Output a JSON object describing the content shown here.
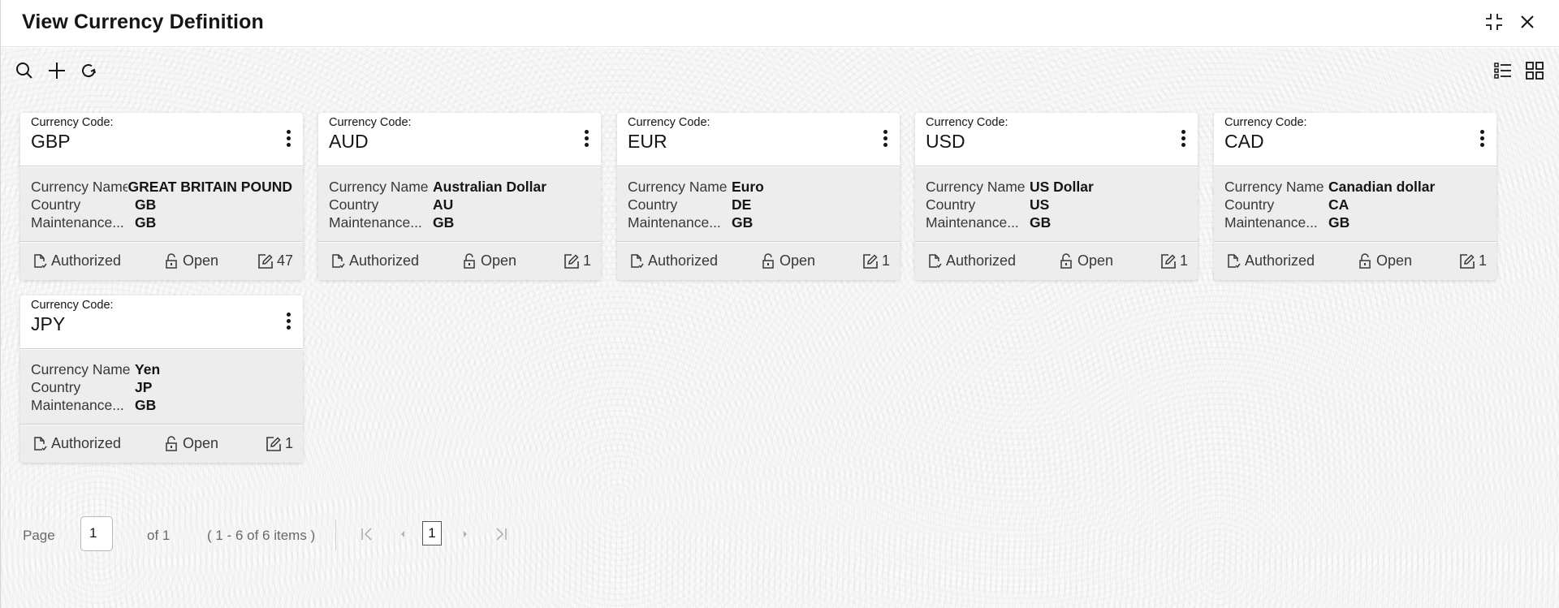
{
  "window": {
    "title": "View Currency Definition",
    "controls": {
      "minimize_icon": "collapse-icon",
      "close_icon": "close-icon"
    }
  },
  "toolbar": {
    "left": [
      "search-icon",
      "add-icon",
      "refresh-icon"
    ],
    "right": [
      "list-view-icon",
      "tile-view-icon"
    ]
  },
  "card_labels": {
    "code_label": "Currency Code:",
    "currency_name": "Currency Name",
    "country": "Country",
    "maintenance": "Maintenance..."
  },
  "cards": [
    {
      "code": "GBP",
      "currency_name": "GREAT BRITAIN POUND",
      "country": "GB",
      "maintenance": "GB",
      "auth_status": "Authorized",
      "record_status": "Open",
      "mod_count": "47"
    },
    {
      "code": "AUD",
      "currency_name": "Australian Dollar",
      "country": "AU",
      "maintenance": "GB",
      "auth_status": "Authorized",
      "record_status": "Open",
      "mod_count": "1"
    },
    {
      "code": "EUR",
      "currency_name": "Euro",
      "country": "DE",
      "maintenance": "GB",
      "auth_status": "Authorized",
      "record_status": "Open",
      "mod_count": "1"
    },
    {
      "code": "USD",
      "currency_name": "US Dollar",
      "country": "US",
      "maintenance": "GB",
      "auth_status": "Authorized",
      "record_status": "Open",
      "mod_count": "1"
    },
    {
      "code": "CAD",
      "currency_name": "Canadian dollar",
      "country": "CA",
      "maintenance": "GB",
      "auth_status": "Authorized",
      "record_status": "Open",
      "mod_count": "1"
    },
    {
      "code": "JPY",
      "currency_name": "Yen",
      "country": "JP",
      "maintenance": "GB",
      "auth_status": "Authorized",
      "record_status": "Open",
      "mod_count": "1"
    }
  ],
  "pagination": {
    "page_label": "Page",
    "page_value": "1",
    "of_label": "of 1",
    "items_summary": "( 1 - 6 of 6 items )",
    "current_page": "1"
  },
  "colors": {
    "text": "#161513",
    "card_body_bg": "#ededed",
    "muted": "#6b6965"
  }
}
